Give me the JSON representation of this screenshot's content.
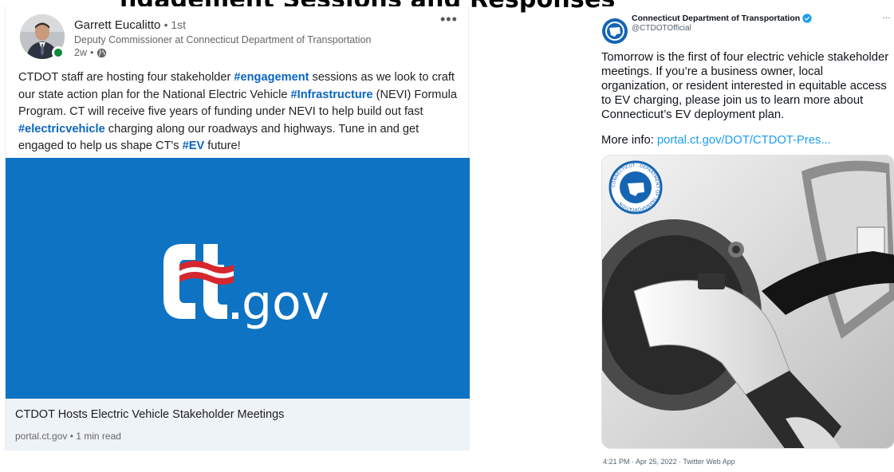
{
  "linkedin": {
    "author_name": "Garrett Eucalitto",
    "connection_degree": "1st",
    "headline": "Deputy Commissioner at Connecticut Department of Transportation",
    "time_ago": "2w",
    "more_label": "•••",
    "post_segments": [
      {
        "text": "CTDOT staff are hosting four stakeholder ",
        "tag": false
      },
      {
        "text": "#engagement",
        "tag": true
      },
      {
        "text": " sessions as we look to craft our state action plan for the National Electric Vehicle ",
        "tag": false
      },
      {
        "text": "#Infrastructure",
        "tag": true
      },
      {
        "text": " (NEVI) Formula Program. CT will receive five years of funding under NEVI to help build out fast ",
        "tag": false
      },
      {
        "text": "#electricvehicle",
        "tag": true
      },
      {
        "text": " charging along our roadways and highways. Tune in and get engaged to help us shape CT's ",
        "tag": false
      },
      {
        "text": "#EV",
        "tag": true
      },
      {
        "text": " future!",
        "tag": false
      }
    ],
    "link_title": "CTDOT Hosts Electric Vehicle Stakeholder Meetings",
    "link_meta": "portal.ct.gov • 1 min read",
    "image_bg_color": "#0f73c4",
    "hashtag_color": "#0a66c2",
    "logo_text": "gov"
  },
  "twitter": {
    "display_name": "Connecticut Department of Transportation",
    "handle": "@CTDOTOfficial",
    "more_label": "…",
    "tweet_text": "Tomorrow is the first of four electric vehicle stakeholder meetings. If you’re a business owner, local organization, or resident interested in equitable access to EV charging, please join us to learn more about Connecticut’s EV deployment plan.",
    "info_prefix": "More info: ",
    "info_link": "portal.ct.gov/DOT/CTDOT-Pres...",
    "timestamp": "4:21 PM · Apr 25, 2022 · Twitter Web App",
    "seal_text": "CONNECTICUT · DEPARTMENT OF TRANSPORTATION ·",
    "link_color": "#1d9bf0",
    "verified_color": "#1d9bf0"
  },
  "page": {
    "cropped_heading": "ngagement Sessions and Responses"
  }
}
